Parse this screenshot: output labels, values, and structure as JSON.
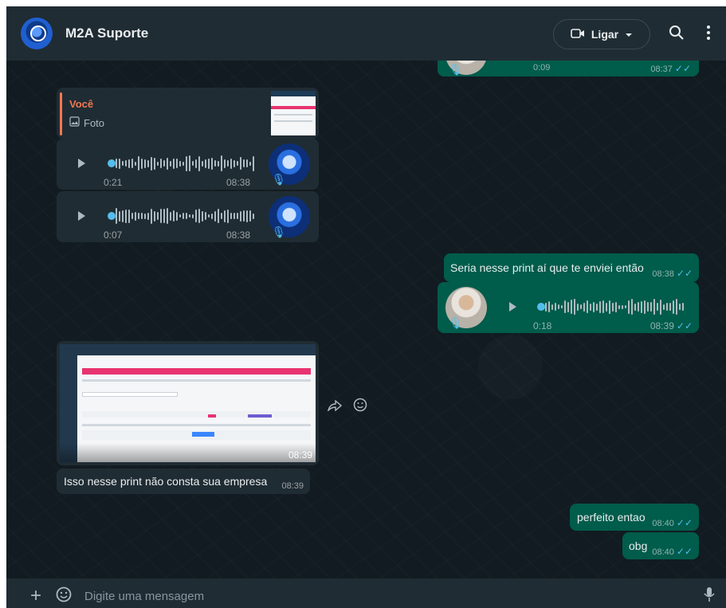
{
  "header": {
    "title": "M2A Suporte",
    "call_label": "Ligar"
  },
  "messages": {
    "top_audio": {
      "duration": "0:09",
      "time": "08:37"
    },
    "quote_card": {
      "author": "Você",
      "kind": "Foto"
    },
    "audio1": {
      "duration": "0:21",
      "time": "08:38"
    },
    "audio2": {
      "duration": "0:07",
      "time": "08:38"
    },
    "out_text1": {
      "text": "Seria nesse print aí que te enviei então",
      "time": "08:38"
    },
    "out_audio": {
      "duration": "0:18",
      "time": "08:39"
    },
    "image_msg": {
      "time": "08:39"
    },
    "in_text1": {
      "text": "Isso nesse print não consta sua empresa",
      "time": "08:39"
    },
    "out_text2": {
      "text": "perfeito entao",
      "time": "08:40"
    },
    "out_text3": {
      "text": "obg",
      "time": "08:40"
    }
  },
  "composer": {
    "placeholder": "Digite uma mensagem"
  },
  "icons": [
    "avatar",
    "video-icon",
    "chevron-down-icon",
    "search-icon",
    "kebab-menu-icon",
    "play-icon",
    "mic-icon",
    "forward-icon",
    "emoji-icon",
    "plus-icon",
    "sticker-icon"
  ]
}
